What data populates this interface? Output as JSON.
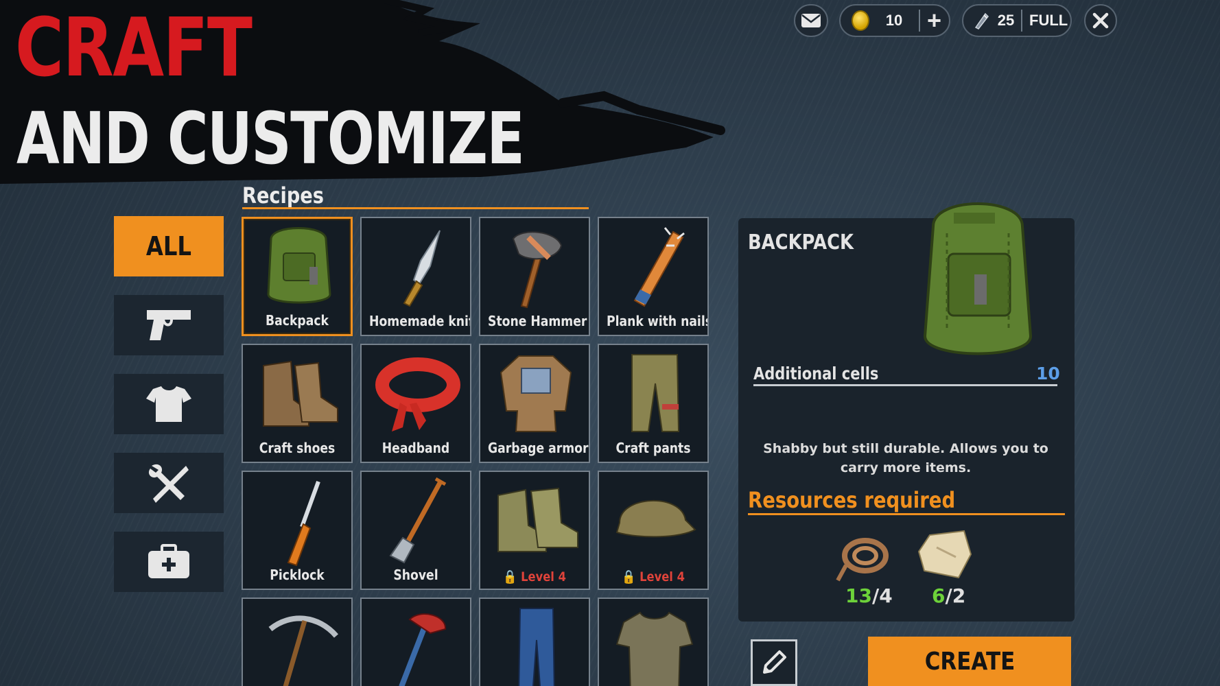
{
  "banner": {
    "line1": "CRAFT",
    "line2": "AND CUSTOMIZE"
  },
  "hud": {
    "mail_icon": "envelope-icon",
    "coins": "10",
    "coins_add_icon": "plus-icon",
    "energy": "25",
    "energy_status": "FULL",
    "close_icon": "close-icon"
  },
  "categories": [
    {
      "label": "ALL",
      "icon": "none",
      "active": true
    },
    {
      "label": "",
      "icon": "pistol-icon",
      "active": false
    },
    {
      "label": "",
      "icon": "tshirt-icon",
      "active": false
    },
    {
      "label": "",
      "icon": "tools-icon",
      "active": false
    },
    {
      "label": "",
      "icon": "medkit-icon",
      "active": false
    }
  ],
  "recipes": {
    "title": "Recipes",
    "items": [
      {
        "label": "Backpack",
        "selected": true
      },
      {
        "label": "Homemade knife"
      },
      {
        "label": "Stone Hammer"
      },
      {
        "label": "Plank with nails"
      },
      {
        "label": "Craft shoes"
      },
      {
        "label": "Headband"
      },
      {
        "label": "Garbage armor"
      },
      {
        "label": "Craft pants"
      },
      {
        "label": "Picklock"
      },
      {
        "label": "Shovel"
      },
      {
        "label": "",
        "lock": "Level 4"
      },
      {
        "label": "",
        "lock": "Level 4"
      },
      {
        "label": ""
      },
      {
        "label": ""
      },
      {
        "label": ""
      },
      {
        "label": ""
      }
    ]
  },
  "detail": {
    "title": "BACKPACK",
    "stat_label": "Additional cells",
    "stat_value": "10",
    "description": "Shabby but still durable. Allows you to carry more items.",
    "resources_title": "Resources required",
    "resources": [
      {
        "icon": "rope-icon",
        "have": "13",
        "need": "/4"
      },
      {
        "icon": "cloth-icon",
        "have": "6",
        "need": "/2"
      }
    ],
    "edit_icon": "pencil-icon",
    "create_label": "CREATE"
  },
  "colors": {
    "accent": "#f0901f",
    "title_red": "#d61a1f",
    "stat_blue": "#5c9ee8",
    "have_green": "#6dd23a",
    "lock_red": "#e0433a"
  }
}
